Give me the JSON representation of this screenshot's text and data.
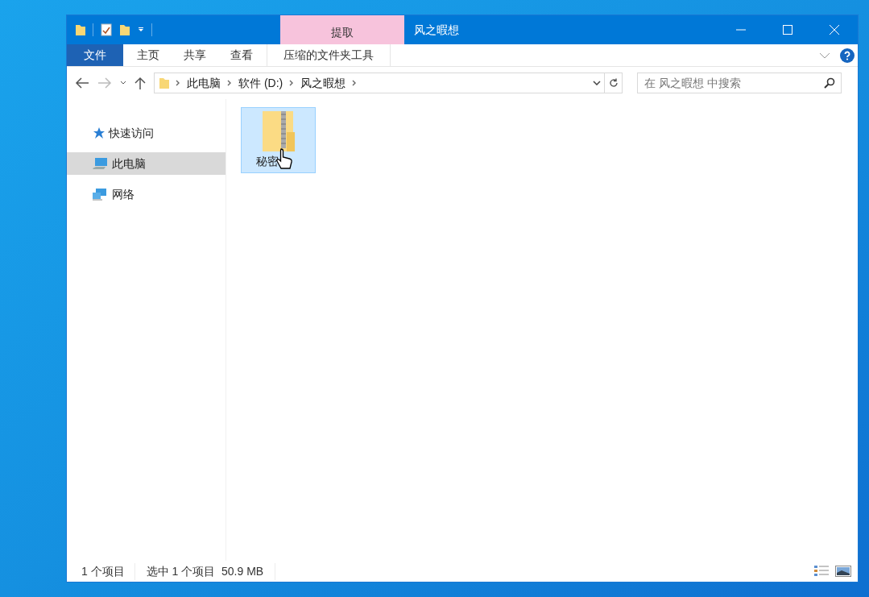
{
  "window": {
    "title": "风之暇想",
    "context_tab_group": "提取"
  },
  "ribbon_tabs": [
    {
      "label": "文件",
      "kind": "file"
    },
    {
      "label": "主页",
      "kind": "normal"
    },
    {
      "label": "共享",
      "kind": "normal"
    },
    {
      "label": "查看",
      "kind": "normal"
    },
    {
      "label": "压缩的文件夹工具",
      "kind": "context"
    }
  ],
  "address_bar": {
    "breadcrumbs": [
      "此电脑",
      "软件 (D:)",
      "风之暇想"
    ]
  },
  "search": {
    "placeholder": "在 风之暇想 中搜索"
  },
  "sidebar": {
    "items": [
      {
        "label": "快速访问",
        "kind": "star",
        "selected": false
      },
      {
        "label": "此电脑",
        "kind": "computer",
        "selected": true
      },
      {
        "label": "网络",
        "kind": "network",
        "selected": false
      }
    ]
  },
  "files": [
    {
      "name": "秘密",
      "selected": true
    }
  ],
  "status_bar": {
    "item_count": "1 个项目",
    "selection": "选中 1 个项目  50.9 MB"
  }
}
